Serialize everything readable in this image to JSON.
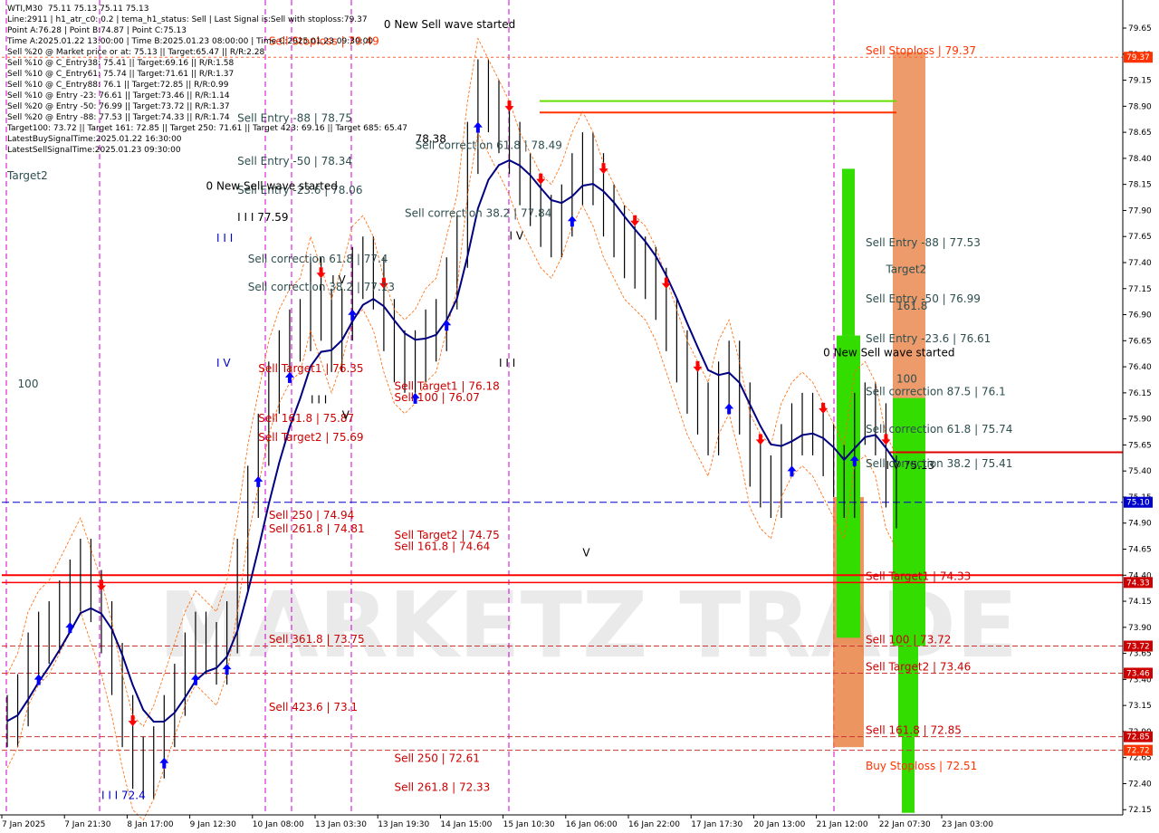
{
  "header": {
    "lines": [
      "WTI,M30  75.11 75.13 75.11 75.13",
      "Line:2911 | h1_atr_c0: 0.2 | tema_h1_status: Sell | Last Signal is:Sell with stoploss:79.37",
      "Point A:76.28 | Point B:74.87 | Point C:75.13",
      "Time A:2025.01.22 13:00:00 | Time B:2025.01.23 08:00:00 | Time C:2025.01.23 09:30:00",
      "Sell %20 @ Market price or at: 75.13 || Target:65.47 || R/R:2.28",
      "Sell %10 @ C_Entry38: 75.41 || Target:69.16 || R/R:1.58",
      "Sell %10 @ C_Entry61: 75.74 || Target:71.61 || R/R:1.37",
      "Sell %10 @ C_Entry88: 76.1 || Target:72.85 || R/R:0.99",
      "Sell %10 @ Entry -23: 76.61 || Target:73.46 || R/R:1.14",
      "Sell %20 @ Entry -50: 76.99 || Target:73.72 || R/R:1.37",
      "Sell %20 @ Entry -88: 77.53 || Target:74.33 || R/R:1.74",
      "Target100: 73.72 || Target 161: 72.85 || Target 250: 71.61 || Target 423: 69.16 || Target 685: 65.47",
      "LatestBuySignalTime:2025.01.22 16:30:00",
      "LatestSellSignalTime:2025.01.23 09:30:00"
    ]
  },
  "chart_data": {
    "type": "line",
    "symbol": "WTI,M30",
    "ylim": [
      72.1,
      79.85
    ],
    "y_ticks": [
      79.65,
      79.4,
      79.15,
      78.9,
      78.65,
      78.4,
      78.15,
      77.9,
      77.65,
      77.4,
      77.15,
      76.9,
      76.65,
      76.4,
      76.15,
      75.9,
      75.65,
      75.4,
      75.15,
      74.9,
      74.65,
      74.4,
      74.15,
      73.9,
      73.65,
      73.4,
      73.15,
      72.9,
      72.65,
      72.4,
      72.15
    ],
    "x_ticks": [
      "7 Jan 2025",
      "7 Jan 21:30",
      "8 Jan 17:00",
      "9 Jan 12:30",
      "10 Jan 08:00",
      "13 Jan 03:30",
      "13 Jan 19:30",
      "14 Jan 15:00",
      "15 Jan 10:30",
      "16 Jan 06:00",
      "16 Jan 22:00",
      "17 Jan 17:30",
      "20 Jan 13:00",
      "21 Jan 12:00",
      "22 Jan 07:30",
      "23 Jan 03:00"
    ],
    "series": [
      {
        "type": "close",
        "values": [
          73.0,
          73.2,
          73.6,
          73.8,
          73.9,
          74.1,
          74.3,
          74.5,
          74.2,
          73.9,
          73.5,
          73.0,
          72.6,
          72.5,
          72.7,
          73.0,
          73.3,
          73.6,
          73.8,
          73.7,
          73.6,
          73.9,
          74.5,
          75.2,
          75.7,
          76.2,
          76.5,
          76.7,
          76.8,
          77.2,
          76.9,
          76.6,
          76.9,
          77.3,
          77.4,
          77.2,
          76.8,
          76.5,
          76.4,
          76.5,
          76.7,
          76.8,
          77.2,
          77.6,
          78.5,
          79.1,
          78.9,
          78.7,
          78.5,
          78.2,
          78.0,
          77.8,
          77.7,
          77.9,
          78.2,
          78.4,
          78.2,
          77.9,
          77.7,
          77.5,
          77.4,
          77.3,
          77.1,
          76.8,
          76.5,
          76.2,
          76.0,
          75.8,
          76.2,
          76.4,
          76.0,
          75.5,
          75.3,
          75.2,
          75.6,
          75.8,
          75.9,
          75.8,
          75.6,
          75.4,
          75.2,
          75.9,
          76.0,
          75.8,
          75.3,
          75.1
        ]
      }
    ],
    "levels": [
      {
        "label": "Sell Stoploss | 79.37",
        "value": 79.37,
        "color": "#ff3300"
      },
      {
        "label": "Sell Entry -88 | 77.53",
        "value": 77.53,
        "color": "#2f4f4f"
      },
      {
        "label": "Sell Entry -50 | 76.99",
        "value": 76.99,
        "color": "#2f4f4f"
      },
      {
        "label": "Sell Entry -23.6 | 76.61",
        "value": 76.61,
        "color": "#2f4f4f"
      },
      {
        "label": "Sell correction 87.5 | 76.1",
        "value": 76.1,
        "color": "#2f4f4f"
      },
      {
        "label": "Sell correction 61.8 | 75.74",
        "value": 75.74,
        "color": "#2f4f4f"
      },
      {
        "label": "Sell correction 38.2 | 75.41",
        "value": 75.41,
        "color": "#2f4f4f"
      },
      {
        "label": "Sell Target1 | 74.33",
        "value": 74.33,
        "color": "#cc0000"
      },
      {
        "label": "Sell 100 | 73.72",
        "value": 73.72,
        "color": "#cc0000"
      },
      {
        "label": "Sell Target2 | 73.46",
        "value": 73.46,
        "color": "#cc0000"
      },
      {
        "label": "Sell 161.8 | 72.85",
        "value": 72.85,
        "color": "#cc0000"
      },
      {
        "label": "Buy Stoploss | 72.51",
        "value": 72.51,
        "color": "#ff3300"
      }
    ],
    "right_badges": [
      {
        "text": "79.37",
        "value": 79.37,
        "color": "#ff3300"
      },
      {
        "text": "75.10",
        "value": 75.1,
        "color": "#0000cc"
      },
      {
        "text": "74.33",
        "value": 74.33,
        "color": "#cc0000"
      },
      {
        "text": "73.72",
        "value": 73.72,
        "color": "#cc0000"
      },
      {
        "text": "73.46",
        "value": 73.46,
        "color": "#cc0000"
      },
      {
        "text": "72.85",
        "value": 72.85,
        "color": "#cc0000"
      },
      {
        "text": "72.72",
        "value": 72.72,
        "color": "#ff3300"
      }
    ],
    "annotations": [
      {
        "text": "0 New Sell wave started",
        "x_idx": 36,
        "y": 79.65,
        "color": "#000000"
      },
      {
        "text": "Sell Stoploss | 79.49",
        "x_idx": 25,
        "y": 79.49,
        "color": "#ff3300"
      },
      {
        "text": "Sell Entry -88 | 78.75",
        "x_idx": 22,
        "y": 78.75,
        "color": "#2f4f4f"
      },
      {
        "text": "Sell Entry -50 | 78.34",
        "x_idx": 22,
        "y": 78.34,
        "color": "#2f4f4f"
      },
      {
        "text": "Sell Entry -23.6 | 78.06",
        "x_idx": 22,
        "y": 78.06,
        "color": "#2f4f4f"
      },
      {
        "text": "0 New Sell wave started",
        "x_idx": 19,
        "y": 78.1,
        "color": "#000000"
      },
      {
        "text": "I I I 77.59",
        "x_idx": 22,
        "y": 77.8,
        "color": "#000000"
      },
      {
        "text": "Sell correction 61.8 | 77.4",
        "x_idx": 23,
        "y": 77.4,
        "color": "#2f4f4f"
      },
      {
        "text": "Sell correction 38.2 | 77.13",
        "x_idx": 23,
        "y": 77.13,
        "color": "#2f4f4f"
      },
      {
        "text": "Sell Target1 | 76.35",
        "x_idx": 24,
        "y": 76.35,
        "color": "#cc0000"
      },
      {
        "text": "Sell 161.8 | 75.87",
        "x_idx": 24,
        "y": 75.87,
        "color": "#cc0000"
      },
      {
        "text": "Sell Target2 | 75.69",
        "x_idx": 24,
        "y": 75.69,
        "color": "#cc0000"
      },
      {
        "text": "Sell 250 | 74.94",
        "x_idx": 25,
        "y": 74.94,
        "color": "#cc0000"
      },
      {
        "text": "Sell 261.8 | 74.81",
        "x_idx": 25,
        "y": 74.81,
        "color": "#cc0000"
      },
      {
        "text": "Sell 361.8 | 73.75",
        "x_idx": 25,
        "y": 73.75,
        "color": "#cc0000"
      },
      {
        "text": "Sell 423.6 | 73.1",
        "x_idx": 25,
        "y": 73.1,
        "color": "#cc0000"
      },
      {
        "text": "78.38",
        "x_idx": 39,
        "y": 78.55,
        "color": "#000000"
      },
      {
        "text": "Sell correction 61.8 | 78.49",
        "x_idx": 39,
        "y": 78.49,
        "color": "#2f4f4f"
      },
      {
        "text": "Sell correction 38.2 | 77.84",
        "x_idx": 38,
        "y": 77.84,
        "color": "#2f4f4f"
      },
      {
        "text": "Sell Target1 | 76.18",
        "x_idx": 37,
        "y": 76.18,
        "color": "#cc0000"
      },
      {
        "text": "Sell 100 | 76.07",
        "x_idx": 37,
        "y": 76.07,
        "color": "#cc0000"
      },
      {
        "text": "Sell Target2 | 74.75",
        "x_idx": 37,
        "y": 74.75,
        "color": "#cc0000"
      },
      {
        "text": "Sell 161.8 | 74.64",
        "x_idx": 37,
        "y": 74.64,
        "color": "#cc0000"
      },
      {
        "text": "Sell 250 | 72.61",
        "x_idx": 37,
        "y": 72.61,
        "color": "#cc0000"
      },
      {
        "text": "Sell 261.8 | 72.33",
        "x_idx": 37,
        "y": 72.33,
        "color": "#cc0000"
      },
      {
        "text": "0 New Sell wave started",
        "x_idx": 78,
        "y": 76.5,
        "color": "#000000"
      },
      {
        "text": "Target2",
        "x_idx": 0,
        "y": 78.2,
        "color": "#2f4f4f"
      },
      {
        "text": "Target2",
        "x_idx": 84,
        "y": 77.3,
        "color": "#2f4f4f"
      },
      {
        "text": "100",
        "x_idx": 1,
        "y": 76.2,
        "color": "#2f4f4f"
      },
      {
        "text": "100",
        "x_idx": 85,
        "y": 76.25,
        "color": "#2f4f4f"
      },
      {
        "text": "161.8",
        "x_idx": 85,
        "y": 76.95,
        "color": "#2f4f4f"
      },
      {
        "text": "I I I 72.4",
        "x_idx": 9,
        "y": 72.25,
        "color": "#0000cc"
      },
      {
        "text": "I I I",
        "x_idx": 20,
        "y": 77.6,
        "color": "#0000cc"
      },
      {
        "text": "I V",
        "x_idx": 31,
        "y": 77.2,
        "color": "#000000"
      },
      {
        "text": "I V",
        "x_idx": 20,
        "y": 76.4,
        "color": "#0000cc"
      },
      {
        "text": "I I I",
        "x_idx": 29,
        "y": 76.05,
        "color": "#000000"
      },
      {
        "text": "V",
        "x_idx": 32,
        "y": 75.9,
        "color": "#000000"
      },
      {
        "text": "I V",
        "x_idx": 48,
        "y": 77.62,
        "color": "#000000"
      },
      {
        "text": "I I I",
        "x_idx": 47,
        "y": 76.4,
        "color": "#000000"
      },
      {
        "text": "V",
        "x_idx": 55,
        "y": 74.58,
        "color": "#000000"
      },
      {
        "text": "I V 75.13",
        "x_idx": 84,
        "y": 75.42,
        "color": "#000000"
      }
    ],
    "x_axis_label": "",
    "y_axis_label": ""
  },
  "watermark": "MARKETZ TRADE",
  "colors": {
    "sell_arrow": "#ff0000",
    "buy_arrow": "#0000ff",
    "signal_arrow": "#ffd700",
    "tema_line": "#000080",
    "channel": "#ff6600",
    "green_zone": "#33dd00",
    "orange_zone": "#e87a3a"
  }
}
